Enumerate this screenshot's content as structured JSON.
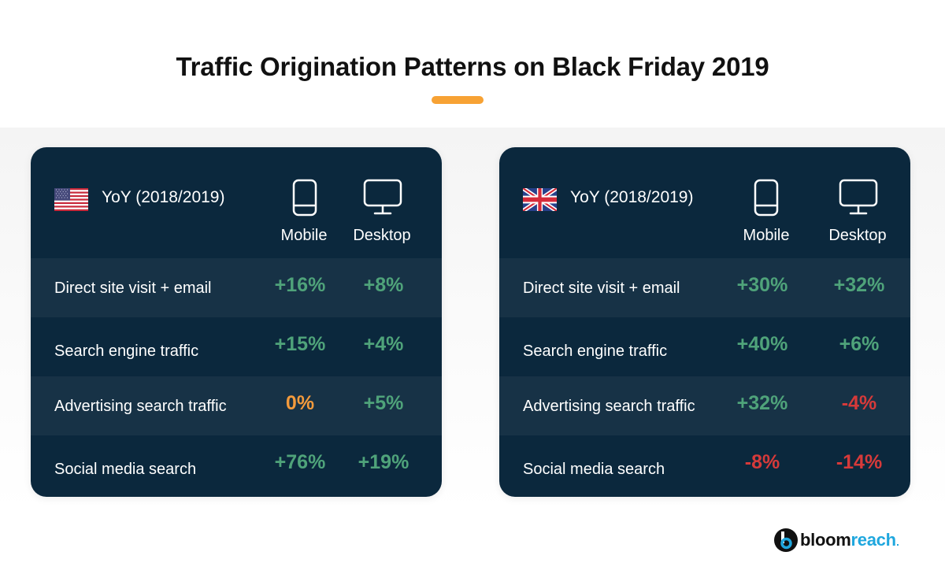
{
  "title": "Traffic Origination Patterns on Black Friday 2019",
  "colors": {
    "accent": "#f7a234",
    "panel_bg": "#0b283d",
    "row_alt_bg": "#173246",
    "positive": "#4fa37a",
    "neutral": "#f39a3c",
    "negative": "#d63a3a",
    "brand_blue": "#1fa7de"
  },
  "panels": [
    {
      "region": "United States",
      "flag_icon": "us-flag-icon",
      "header": "YoY (2018/2019)",
      "columns": [
        {
          "label": "Mobile",
          "icon": "mobile-phone-icon"
        },
        {
          "label": "Desktop",
          "icon": "desktop-monitor-icon"
        }
      ],
      "rows": [
        {
          "label": "Direct site visit + email",
          "mobile": "+16%",
          "desktop": "+8%"
        },
        {
          "label": "Search engine traffic",
          "mobile": "+15%",
          "desktop": "+4%"
        },
        {
          "label": "Advertising search traffic",
          "mobile": "0%",
          "desktop": "+5%"
        },
        {
          "label": "Social media search",
          "mobile": "+76%",
          "desktop": "+19%"
        }
      ]
    },
    {
      "region": "United Kingdom",
      "flag_icon": "uk-flag-icon",
      "header": "YoY (2018/2019)",
      "columns": [
        {
          "label": "Mobile",
          "icon": "mobile-phone-icon"
        },
        {
          "label": "Desktop",
          "icon": "desktop-monitor-icon"
        }
      ],
      "rows": [
        {
          "label": "Direct site visit + email",
          "mobile": "+30%",
          "desktop": "+32%"
        },
        {
          "label": "Search engine traffic",
          "mobile": "+40%",
          "desktop": "+6%"
        },
        {
          "label": "Advertising search traffic",
          "mobile": "+32%",
          "desktop": "-4%"
        },
        {
          "label": "Social media search",
          "mobile": "-8%",
          "desktop": "-14%"
        }
      ]
    }
  ],
  "logo": {
    "part1": "bloom",
    "part2": "reach"
  }
}
